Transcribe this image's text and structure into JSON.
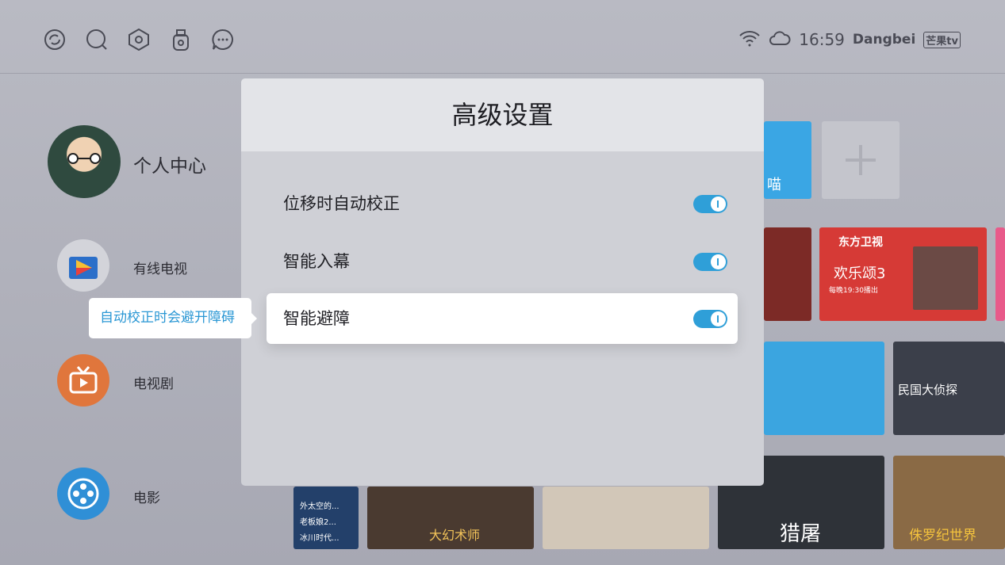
{
  "topbar": {
    "icons": [
      "refresh-icon",
      "search-icon",
      "settings-icon",
      "usb-icon",
      "message-icon"
    ],
    "time": "16:59",
    "brand": "Dangbei",
    "logo": "芒果tv"
  },
  "menu": {
    "profile": "个人中心",
    "items": [
      {
        "label": "有线电视",
        "icon": "tv-cable-icon",
        "color": "#d8d8dd"
      },
      {
        "label": "电视剧",
        "icon": "tv-series-icon",
        "color": "#e57a3d"
      },
      {
        "label": "电影",
        "icon": "movie-reel-icon",
        "color": "#2f8fd6"
      }
    ]
  },
  "tiles": {
    "app_label": "喵",
    "dongfang": "东方卫视",
    "show": "欢乐颂3",
    "show_time": "每晚19:30播出",
    "mingguo": "民国大侦探",
    "movies": [
      "大幻术师",
      "猎屠",
      "侏罗纪世界"
    ],
    "list": [
      "外太空的...",
      "老板娘2...",
      "冰川时代..."
    ]
  },
  "dialog": {
    "title": "高级设置",
    "options": [
      {
        "label": "位移时自动校正",
        "enabled": true
      },
      {
        "label": "智能入幕",
        "enabled": true
      },
      {
        "label": "智能避障",
        "enabled": true
      }
    ]
  },
  "tooltip": {
    "text": "自动校正时会避开障碍"
  },
  "colors": {
    "accent": "#2f9fd8",
    "tooltip_text": "#2a97d4"
  }
}
